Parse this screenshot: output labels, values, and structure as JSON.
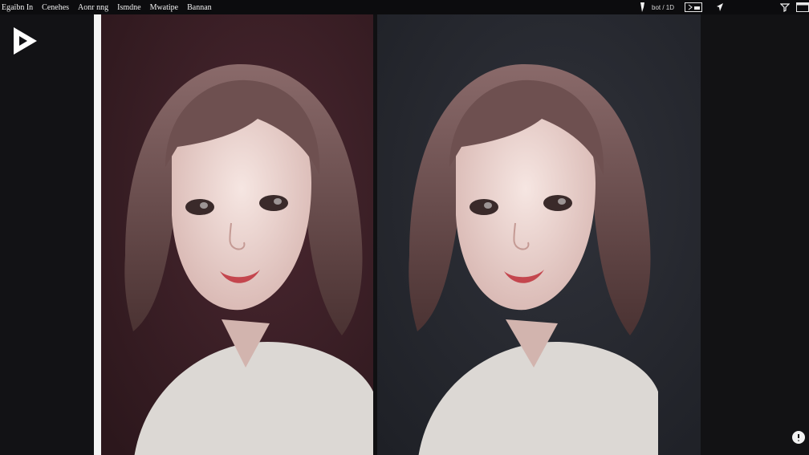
{
  "menu": {
    "items": [
      "Egaibn In",
      "Cenehes",
      "Aonr nng",
      "Ismdne",
      "Mwatipe",
      "Bannan"
    ]
  },
  "toolbar": {
    "counter_text": "bot / 1D"
  },
  "icons": {
    "logo": "play-triangle-icon",
    "pin": "pin-icon",
    "frame": "picture-in-picture-icon",
    "cursor": "cursor-arrow-icon",
    "filter": "filter-icon",
    "window": "window-icon",
    "help": "help-icon"
  },
  "colors": {
    "left_panel_bg": "#3a1f25",
    "right_panel_bg": "#24262c",
    "app_bg": "#141416",
    "divider": "#f4f4f4"
  }
}
